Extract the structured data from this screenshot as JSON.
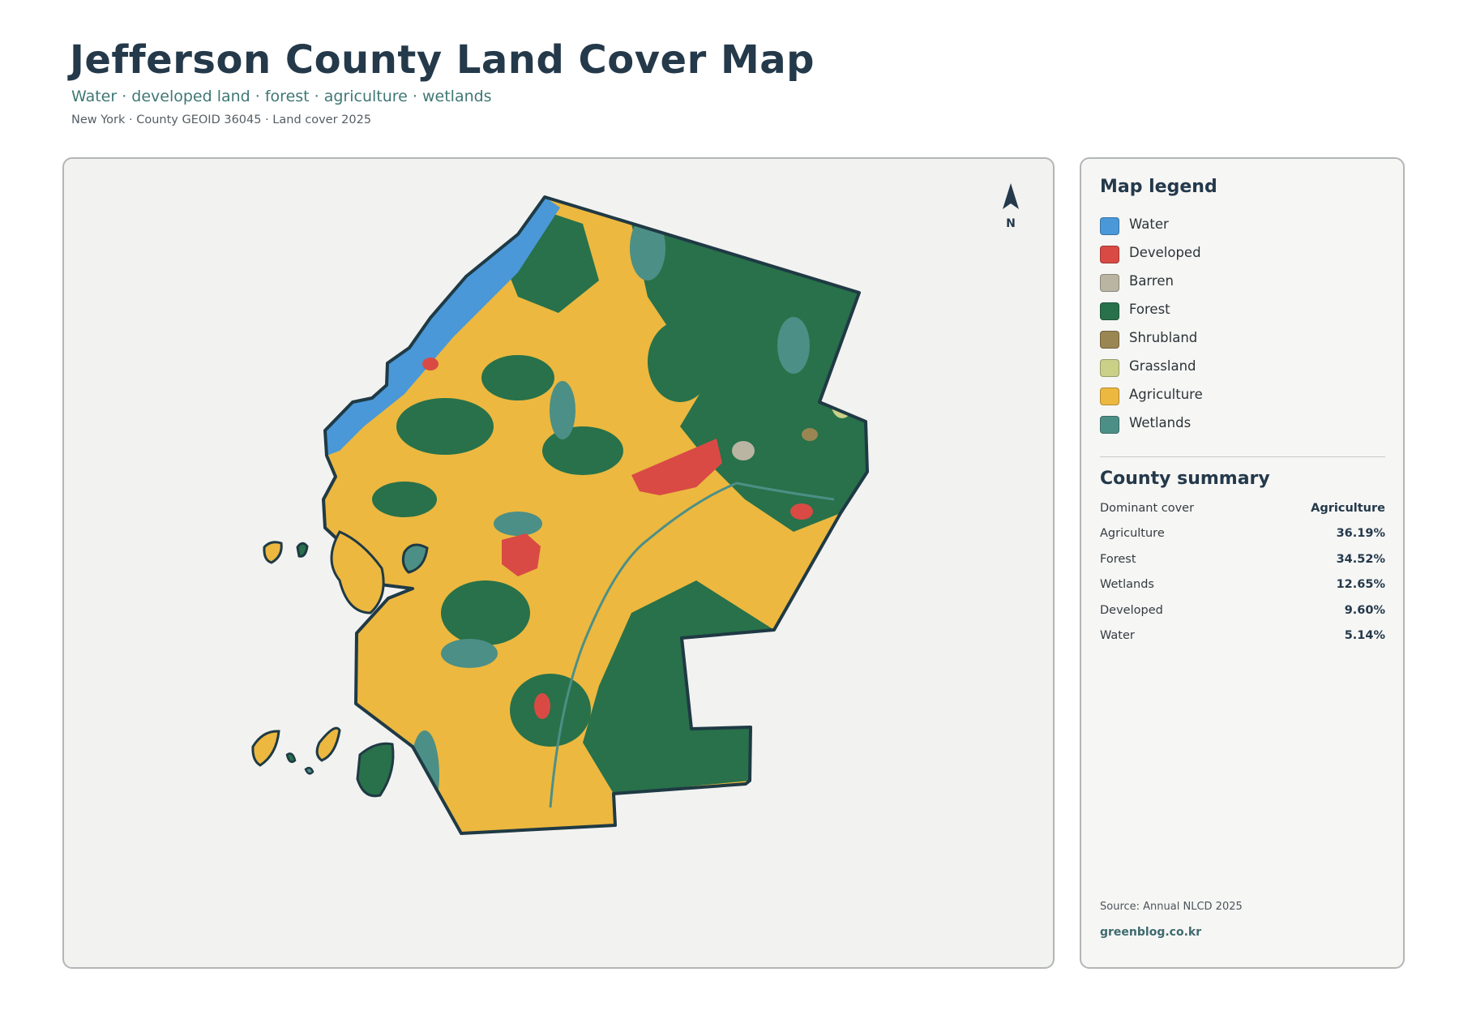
{
  "header": {
    "title": "Jefferson County Land Cover Map",
    "subtitle": "Water · developed land · forest · agriculture · wetlands",
    "meta": "New York · County GEOID 36045 · Land cover 2025"
  },
  "map": {
    "north_label": "N",
    "boundary_color": "#1f3a44"
  },
  "legend": {
    "heading": "Map legend",
    "items": [
      {
        "label": "Water",
        "color": "#4a98d8"
      },
      {
        "label": "Developed",
        "color": "#d94a45"
      },
      {
        "label": "Barren",
        "color": "#bab4a3"
      },
      {
        "label": "Forest",
        "color": "#28714a"
      },
      {
        "label": "Shrubland",
        "color": "#9a8652"
      },
      {
        "label": "Grassland",
        "color": "#cad088"
      },
      {
        "label": "Agriculture",
        "color": "#ecb840"
      },
      {
        "label": "Wetlands",
        "color": "#4c8f86"
      }
    ]
  },
  "summary": {
    "heading": "County summary",
    "rows": [
      {
        "label": "Dominant cover",
        "value": "Agriculture"
      },
      {
        "label": "Agriculture",
        "value": "36.19%"
      },
      {
        "label": "Forest",
        "value": "34.52%"
      },
      {
        "label": "Wetlands",
        "value": "12.65%"
      },
      {
        "label": "Developed",
        "value": "9.60%"
      },
      {
        "label": "Water",
        "value": "5.14%"
      }
    ]
  },
  "footer": {
    "source": "Source: Annual NLCD 2025",
    "credit": "greenblog.co.kr"
  }
}
